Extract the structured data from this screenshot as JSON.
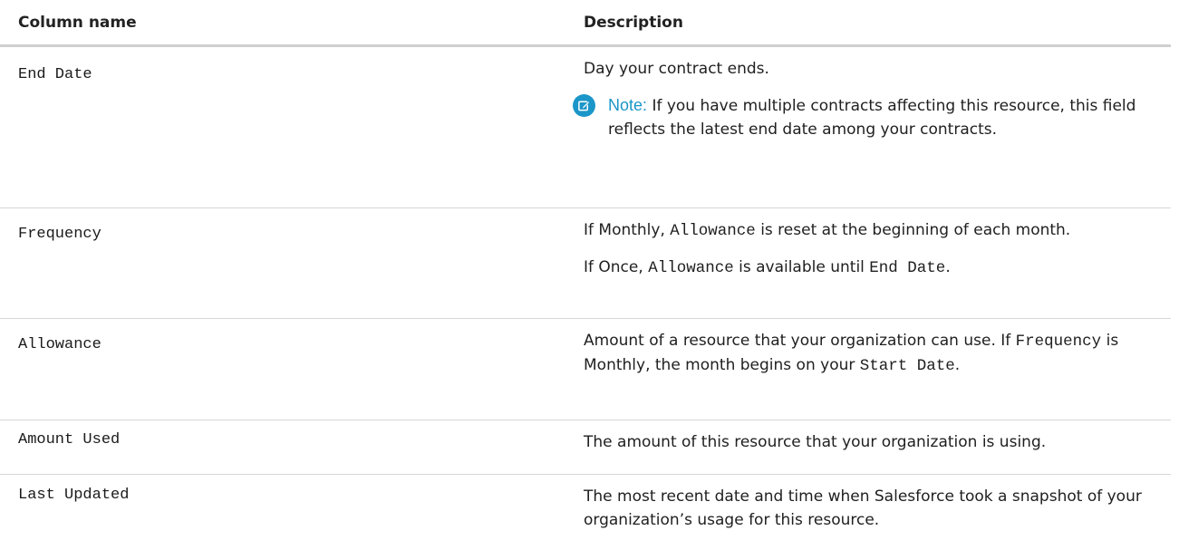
{
  "table": {
    "headers": {
      "name": "Column name",
      "description": "Description"
    },
    "rows": {
      "end_date": {
        "name": "End Date",
        "description": "Day your contract ends.",
        "note_label": "Note:",
        "note_text": "If you have multiple contracts affecting this resource, this field reflects the latest end date among your contracts."
      },
      "frequency": {
        "name": "Frequency",
        "line1_prefix": "If Monthly,",
        "line1_code": "Allowance",
        "line1_suffix": "is reset at the beginning of each month.",
        "line2_prefix": "If Once,",
        "line2_code": "Allowance",
        "line2_middle": "is available until",
        "line2_code2": "End Date",
        "line2_suffix": "."
      },
      "allowance": {
        "name": "Allowance",
        "text_prefix": "Amount of a resource that your organization can use. If",
        "code1": "Frequency",
        "text_middle": "is Monthly, the month begins on your",
        "code2": "Start Date",
        "text_suffix": "."
      },
      "amount_used": {
        "name": "Amount Used",
        "description": "The amount of this resource that your organization is using."
      },
      "last_updated": {
        "name": "Last Updated",
        "description": "The most recent date and time when Salesforce took a snapshot of your organization’s usage for this resource."
      }
    }
  },
  "colors": {
    "note_accent": "#1b96c8",
    "header_rule": "#cfcfcf",
    "row_rule": "#d6d6d6"
  },
  "icons": {
    "note": "edit-note-icon"
  }
}
